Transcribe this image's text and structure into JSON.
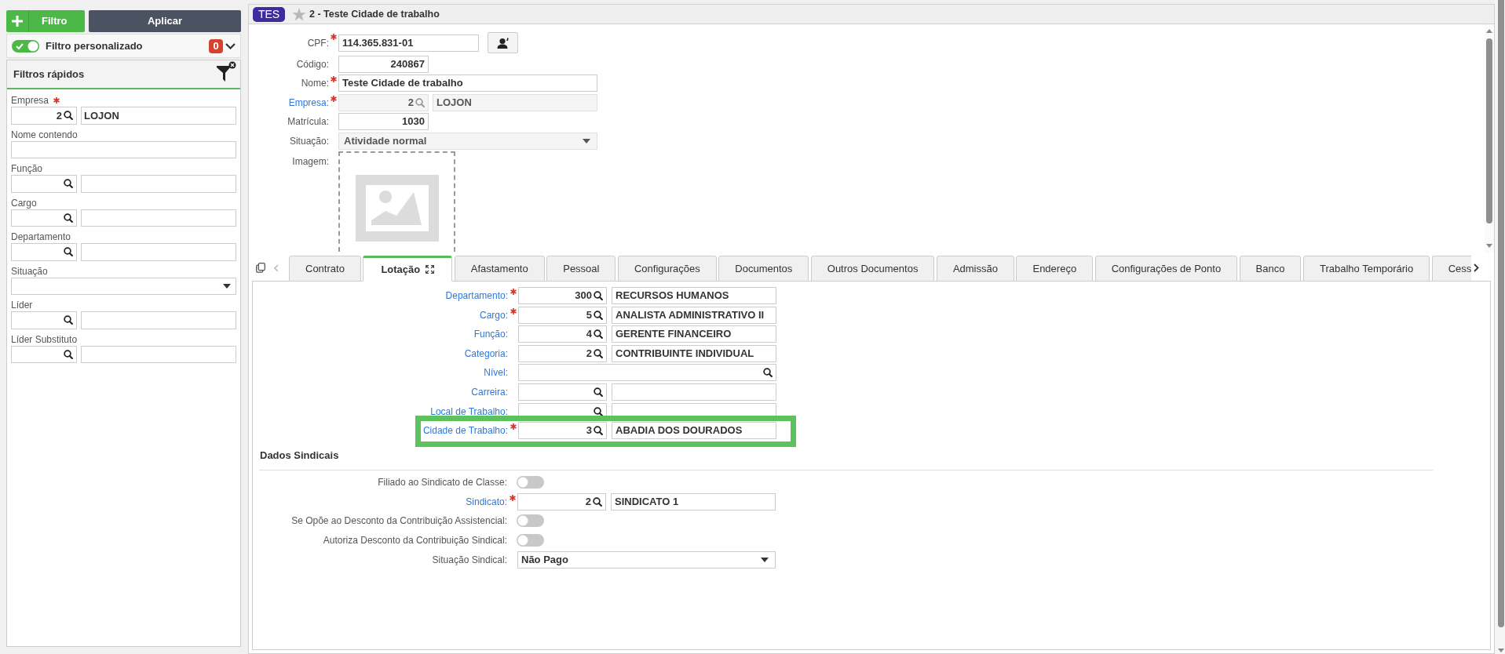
{
  "sidebar": {
    "buttons": [
      {
        "kind": "add",
        "label": "Filtro"
      },
      {
        "kind": "apply",
        "label": "Aplicar"
      }
    ],
    "custom_filter": {
      "label": "Filtro personalizado",
      "on": true,
      "count": "0",
      "expanded": false
    },
    "quick_filters": {
      "title": "Filtros rápidos",
      "fields": [
        {
          "kind": "lookup",
          "label": "Empresa",
          "required": true,
          "code": "2",
          "name": "LOJON"
        },
        {
          "kind": "text",
          "label": "Nome contendo",
          "required": false
        },
        {
          "kind": "lookup",
          "label": "Função",
          "required": false
        },
        {
          "kind": "lookup",
          "label": "Cargo",
          "required": false
        },
        {
          "kind": "lookup",
          "label": "Departamento",
          "required": false
        },
        {
          "kind": "select",
          "label": "Situação",
          "required": false
        },
        {
          "kind": "lookup",
          "label": "Líder",
          "required": false
        },
        {
          "kind": "lookup",
          "label": "Líder Substituto",
          "required": false
        }
      ]
    }
  },
  "record": {
    "badge": "TES",
    "favorite": false,
    "title": "2 - Teste Cidade de trabalho",
    "fields": [
      {
        "kind": "cpf",
        "label": "CPF:",
        "required": true,
        "link": false,
        "disabled": false,
        "value": "114.365.831-01"
      },
      {
        "kind": "number",
        "label": "Código:",
        "required": false,
        "link": false,
        "disabled": false,
        "value": "240867"
      },
      {
        "kind": "text",
        "label": "Nome:",
        "required": true,
        "link": false,
        "disabled": false,
        "value": "Teste Cidade de trabalho"
      },
      {
        "kind": "lookup",
        "label": "Empresa:",
        "required": true,
        "link": true,
        "disabled": true,
        "code": "2",
        "name": "LOJON"
      },
      {
        "kind": "number",
        "label": "Matrícula:",
        "required": false,
        "link": false,
        "disabled": false,
        "value": "1030"
      },
      {
        "kind": "select",
        "label": "Situação:",
        "required": false,
        "link": false,
        "disabled": true,
        "value": "Atividade normal"
      },
      {
        "kind": "image",
        "label": "Imagem:",
        "required": false,
        "link": false
      }
    ]
  },
  "tabs": [
    {
      "label": "Contrato",
      "selected": false
    },
    {
      "label": "Lotação",
      "selected": true
    },
    {
      "label": "Afastamento",
      "selected": false
    },
    {
      "label": "Pessoal",
      "selected": false
    },
    {
      "label": "Configurações",
      "selected": false
    },
    {
      "label": "Documentos",
      "selected": false
    },
    {
      "label": "Outros Documentos",
      "selected": false
    },
    {
      "label": "Admissão",
      "selected": false
    },
    {
      "label": "Endereço",
      "selected": false
    },
    {
      "label": "Configurações de Ponto",
      "selected": false
    },
    {
      "label": "Banco",
      "selected": false
    },
    {
      "label": "Trabalho Temporário",
      "selected": false
    },
    {
      "label": "Cess",
      "selected": false
    }
  ],
  "lotacao": {
    "fields": [
      {
        "kind": "lookup",
        "label": "Departamento:",
        "required": true,
        "link": true,
        "highlighted": false,
        "code": "300",
        "name": "RECURSOS HUMANOS"
      },
      {
        "kind": "lookup",
        "label": "Cargo:",
        "required": true,
        "link": true,
        "highlighted": false,
        "code": "5",
        "name": "ANALISTA ADMINISTRATIVO II"
      },
      {
        "kind": "lookup",
        "label": "Função:",
        "required": false,
        "link": true,
        "highlighted": false,
        "code": "4",
        "name": "GERENTE FINANCEIRO"
      },
      {
        "kind": "lookup",
        "label": "Categoria:",
        "required": false,
        "link": true,
        "highlighted": false,
        "code": "2",
        "name": "CONTRIBUINTE INDIVIDUAL"
      },
      {
        "kind": "wide_lookup",
        "label": "Nível:",
        "required": false,
        "link": true,
        "highlighted": false
      },
      {
        "kind": "lookup",
        "label": "Carreira:",
        "required": false,
        "link": true,
        "highlighted": false
      },
      {
        "kind": "lookup",
        "label": "Local de Trabalho:",
        "required": false,
        "link": true,
        "highlighted": false
      },
      {
        "kind": "lookup",
        "label": "Cidade de Trabalho:",
        "required": true,
        "link": true,
        "highlighted": true,
        "code": "3",
        "name": "ABADIA DOS DOURADOS"
      }
    ]
  },
  "union": {
    "title": "Dados Sindicais",
    "fields": [
      {
        "kind": "toggle",
        "label": "Filiado ao Sindicato de Classe:",
        "required": false,
        "link": false,
        "on": false
      },
      {
        "kind": "lookup",
        "label": "Sindicato:",
        "required": true,
        "link": true,
        "code": "2",
        "name": "SINDICATO 1"
      },
      {
        "kind": "toggle",
        "label": "Se Opõe ao Desconto da Contribuição Assistencial:",
        "required": false,
        "link": false,
        "on": false
      },
      {
        "kind": "toggle",
        "label": "Autoriza Desconto da Contribuição Sindical:",
        "required": false,
        "link": false,
        "on": false
      },
      {
        "kind": "select",
        "label": "Situação Sindical:",
        "required": false,
        "link": false,
        "value": "Não Pago"
      }
    ]
  }
}
